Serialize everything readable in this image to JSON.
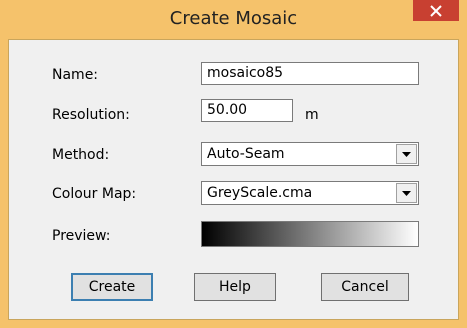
{
  "window": {
    "title": "Create Mosaic",
    "close_symbol": "✕"
  },
  "form": {
    "name_label": "Name:",
    "name_value": "mosaico85",
    "resolution_label": "Resolution:",
    "resolution_value": "50.00",
    "resolution_unit": "m",
    "method_label": "Method:",
    "method_value": "Auto-Seam",
    "colour_map_label": "Colour Map:",
    "colour_map_value": "GreyScale.cma",
    "preview_label": "Preview:"
  },
  "buttons": {
    "create": "Create",
    "help": "Help",
    "cancel": "Cancel"
  },
  "icons": {
    "close": "close-icon",
    "dropdown": "chevron-down-icon"
  },
  "colors": {
    "frame": "#f5c26b",
    "close_button": "#c84031",
    "preview_start": "#000000",
    "preview_end": "#ffffff"
  }
}
